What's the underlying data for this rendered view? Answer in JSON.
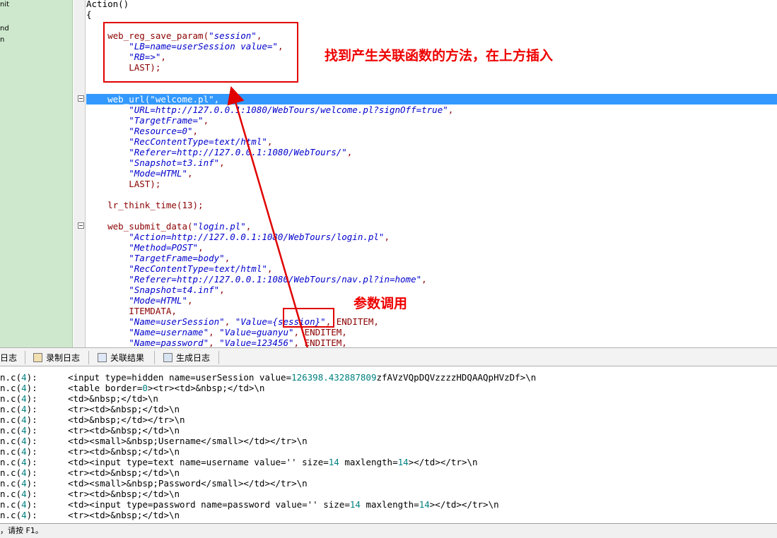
{
  "tree": {
    "items": [
      "nit",
      "nd",
      "n"
    ]
  },
  "editor": {
    "lines": [
      {
        "segments": [
          {
            "t": "Action()",
            "c": "plain"
          }
        ]
      },
      {
        "segments": [
          {
            "t": "{",
            "c": "plain"
          }
        ]
      },
      {
        "segments": []
      },
      {
        "segments": [
          {
            "t": "\tweb_reg_save_param(",
            "c": "kw"
          },
          {
            "t": "\"session\"",
            "c": "str"
          },
          {
            "t": ",",
            "c": "kw"
          }
        ]
      },
      {
        "segments": [
          {
            "t": "\t\t",
            "c": "plain"
          },
          {
            "t": "\"LB=name=userSession value=\"",
            "c": "str"
          },
          {
            "t": ",",
            "c": "kw"
          }
        ]
      },
      {
        "segments": [
          {
            "t": "\t\t",
            "c": "plain"
          },
          {
            "t": "\"RB=>\"",
            "c": "str"
          },
          {
            "t": ",",
            "c": "kw"
          }
        ]
      },
      {
        "segments": [
          {
            "t": "\t\tLAST);",
            "c": "kw"
          }
        ]
      },
      {
        "segments": []
      },
      {
        "segments": []
      },
      {
        "segments": [
          {
            "t": "\tweb_url(\"welcome.pl\",",
            "c": "plain"
          }
        ],
        "highlight": true
      },
      {
        "segments": [
          {
            "t": "\t\t",
            "c": "plain"
          },
          {
            "t": "\"URL=http://127.0.0.1:1080/WebTours/welcome.pl?signOff=true\"",
            "c": "str"
          },
          {
            "t": ",",
            "c": "kw"
          }
        ]
      },
      {
        "segments": [
          {
            "t": "\t\t",
            "c": "plain"
          },
          {
            "t": "\"TargetFrame=\"",
            "c": "str"
          },
          {
            "t": ",",
            "c": "kw"
          }
        ]
      },
      {
        "segments": [
          {
            "t": "\t\t",
            "c": "plain"
          },
          {
            "t": "\"Resource=0\"",
            "c": "str"
          },
          {
            "t": ",",
            "c": "kw"
          }
        ]
      },
      {
        "segments": [
          {
            "t": "\t\t",
            "c": "plain"
          },
          {
            "t": "\"RecContentType=text/html\"",
            "c": "str"
          },
          {
            "t": ",",
            "c": "kw"
          }
        ]
      },
      {
        "segments": [
          {
            "t": "\t\t",
            "c": "plain"
          },
          {
            "t": "\"Referer=http://127.0.0.1:1080/WebTours/\"",
            "c": "str"
          },
          {
            "t": ",",
            "c": "kw"
          }
        ]
      },
      {
        "segments": [
          {
            "t": "\t\t",
            "c": "plain"
          },
          {
            "t": "\"Snapshot=t3.inf\"",
            "c": "str"
          },
          {
            "t": ",",
            "c": "kw"
          }
        ]
      },
      {
        "segments": [
          {
            "t": "\t\t",
            "c": "plain"
          },
          {
            "t": "\"Mode=HTML\"",
            "c": "str"
          },
          {
            "t": ",",
            "c": "kw"
          }
        ]
      },
      {
        "segments": [
          {
            "t": "\t\tLAST);",
            "c": "kw"
          }
        ]
      },
      {
        "segments": []
      },
      {
        "segments": [
          {
            "t": "\tlr_think_time(13);",
            "c": "kw"
          }
        ]
      },
      {
        "segments": []
      },
      {
        "segments": [
          {
            "t": "\tweb_submit_data(",
            "c": "kw"
          },
          {
            "t": "\"login.pl\"",
            "c": "str"
          },
          {
            "t": ",",
            "c": "kw"
          }
        ]
      },
      {
        "segments": [
          {
            "t": "\t\t",
            "c": "plain"
          },
          {
            "t": "\"Action=http://127.0.0.1:1080/WebTours/login.pl\"",
            "c": "str"
          },
          {
            "t": ",",
            "c": "kw"
          }
        ]
      },
      {
        "segments": [
          {
            "t": "\t\t",
            "c": "plain"
          },
          {
            "t": "\"Method=POST\"",
            "c": "str"
          },
          {
            "t": ",",
            "c": "kw"
          }
        ]
      },
      {
        "segments": [
          {
            "t": "\t\t",
            "c": "plain"
          },
          {
            "t": "\"TargetFrame=body\"",
            "c": "str"
          },
          {
            "t": ",",
            "c": "kw"
          }
        ]
      },
      {
        "segments": [
          {
            "t": "\t\t",
            "c": "plain"
          },
          {
            "t": "\"RecContentType=text/html\"",
            "c": "str"
          },
          {
            "t": ",",
            "c": "kw"
          }
        ]
      },
      {
        "segments": [
          {
            "t": "\t\t",
            "c": "plain"
          },
          {
            "t": "\"Referer=http://127.0.0.1:1080/WebTours/nav.pl?in=home\"",
            "c": "str"
          },
          {
            "t": ",",
            "c": "kw"
          }
        ]
      },
      {
        "segments": [
          {
            "t": "\t\t",
            "c": "plain"
          },
          {
            "t": "\"Snapshot=t4.inf\"",
            "c": "str"
          },
          {
            "t": ",",
            "c": "kw"
          }
        ]
      },
      {
        "segments": [
          {
            "t": "\t\t",
            "c": "plain"
          },
          {
            "t": "\"Mode=HTML\"",
            "c": "str"
          },
          {
            "t": ",",
            "c": "kw"
          }
        ]
      },
      {
        "segments": [
          {
            "t": "\t\tITEMDATA,",
            "c": "kw"
          }
        ]
      },
      {
        "segments": [
          {
            "t": "\t\t",
            "c": "plain"
          },
          {
            "t": "\"Name=userSession\"",
            "c": "str"
          },
          {
            "t": ", ",
            "c": "kw"
          },
          {
            "t": "\"Value={session}\"",
            "c": "str"
          },
          {
            "t": ", ENDITEM,",
            "c": "kw"
          }
        ]
      },
      {
        "segments": [
          {
            "t": "\t\t",
            "c": "plain"
          },
          {
            "t": "\"Name=username\"",
            "c": "str"
          },
          {
            "t": ", ",
            "c": "kw"
          },
          {
            "t": "\"Value=guanyu\"",
            "c": "str"
          },
          {
            "t": ", ENDITEM,",
            "c": "kw"
          }
        ]
      },
      {
        "segments": [
          {
            "t": "\t\t",
            "c": "plain"
          },
          {
            "t": "\"Name=password\"",
            "c": "str"
          },
          {
            "t": ", ",
            "c": "kw"
          },
          {
            "t": "\"Value=123456\"",
            "c": "str"
          },
          {
            "t": ", ENDITEM,",
            "c": "kw"
          }
        ]
      }
    ]
  },
  "annotations": {
    "insert_note": "找到产生关联函数的方法，在上方插入",
    "param_note": "参数调用"
  },
  "tabs": {
    "first": "日志",
    "record_log": "录制日志",
    "correlation_results": "关联结果",
    "generation_log": "生成日志"
  },
  "log": {
    "lines": [
      {
        "src": "n.c(4):",
        "msg": "<input type=hidden name=userSession value=126398.432887809zfAVzVQpDQVzzzzHDQAAQpHVzDf>\\n"
      },
      {
        "src": "n.c(4):",
        "msg": "<table border=0><tr><td>&nbsp;</td>\\n"
      },
      {
        "src": "n.c(4):",
        "msg": "<td>&nbsp;</td>\\n"
      },
      {
        "src": "n.c(4):",
        "msg": "<tr><td>&nbsp;</td>\\n"
      },
      {
        "src": "n.c(4):",
        "msg": "<td>&nbsp;</td></tr>\\n"
      },
      {
        "src": "n.c(4):",
        "msg": "<tr><td>&nbsp;</td>\\n"
      },
      {
        "src": "n.c(4):",
        "msg": "<td><small>&nbsp;Username</small></td></tr>\\n"
      },
      {
        "src": "n.c(4):",
        "msg": "<tr><td>&nbsp;</td>\\n"
      },
      {
        "src": "n.c(4):",
        "msg": "<td><input type=text name=username value='' size=14 maxlength=14></td></tr>\\n"
      },
      {
        "src": "n.c(4):",
        "msg": "<tr><td>&nbsp;</td>\\n"
      },
      {
        "src": "n.c(4):",
        "msg": "<td><small>&nbsp;Password</small></td></tr>\\n"
      },
      {
        "src": "n.c(4):",
        "msg": "<tr><td>&nbsp;</td>\\n"
      },
      {
        "src": "n.c(4):",
        "msg": "<td><input type=password name=password value='' size=14 maxlength=14></td></tr>\\n"
      },
      {
        "src": "n.c(4):",
        "msg": "<tr><td>&nbsp;</td>\\n"
      }
    ]
  },
  "status": {
    "text": "，请按 F1。"
  },
  "colors": {
    "highlight": "#3399ff",
    "annotation": "#e00000",
    "keyword": "#8b0000",
    "string": "#0000cc",
    "number": "#008080"
  }
}
